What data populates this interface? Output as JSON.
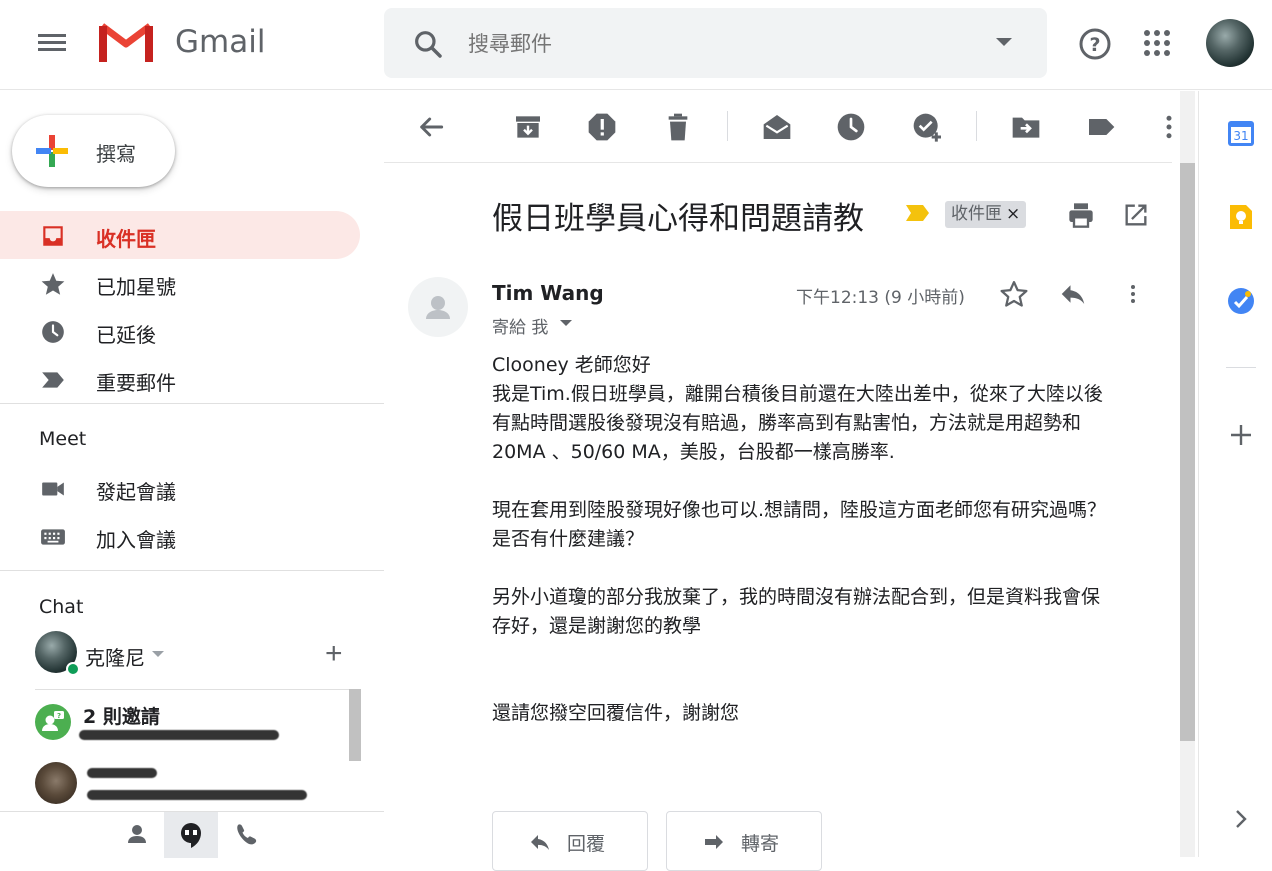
{
  "app": {
    "name": "Gmail"
  },
  "search": {
    "placeholder": "搜尋郵件"
  },
  "compose": {
    "label": "撰寫"
  },
  "nav": {
    "items": [
      {
        "label": "收件匣",
        "icon": "inbox-icon",
        "active": true
      },
      {
        "label": "已加星號",
        "icon": "star-icon"
      },
      {
        "label": "已延後",
        "icon": "clock-icon"
      },
      {
        "label": "重要郵件",
        "icon": "important-icon"
      }
    ]
  },
  "meet": {
    "title": "Meet",
    "items": [
      {
        "label": "發起會議",
        "icon": "video-camera-icon"
      },
      {
        "label": "加入會議",
        "icon": "keyboard-icon"
      }
    ]
  },
  "chat": {
    "title": "Chat",
    "me": {
      "name": "克隆尼"
    },
    "invites": {
      "title": "2 則邀請"
    }
  },
  "message": {
    "subject": "假日班學員心得和問題請教",
    "label_chip": "收件匣",
    "label_remove": "×",
    "sender": "Tim Wang",
    "to": "寄給 我",
    "time": "下午12:13 (9 小時前)",
    "body": [
      "Clooney 老師您好\n我是Tim.假日班學員，離開台積後目前還在大陸出差中，從來了大陸以後\n有點時間選股後發現沒有賠過，勝率高到有點害怕，方法就是用超勢和\n20MA 、50/60 MA，美股，台股都一樣高勝率.",
      "現在套用到陸股發現好像也可以.想請問，陸股這方面老師您有研究過嗎？\n是否有什麼建議？",
      "另外小道瓊的部分我放棄了，我的時間沒有辦法配合到，但是資料我會保\n存好，還是謝謝您的教學",
      "還請您撥空回覆信件，謝謝您"
    ]
  },
  "actions": {
    "reply": "回覆",
    "forward": "轉寄"
  },
  "rightbar": {
    "calendar_day": "31"
  },
  "colors": {
    "accent_red": "#d93025",
    "active_bg": "#fce8e6",
    "online_green": "#0f9d58"
  }
}
